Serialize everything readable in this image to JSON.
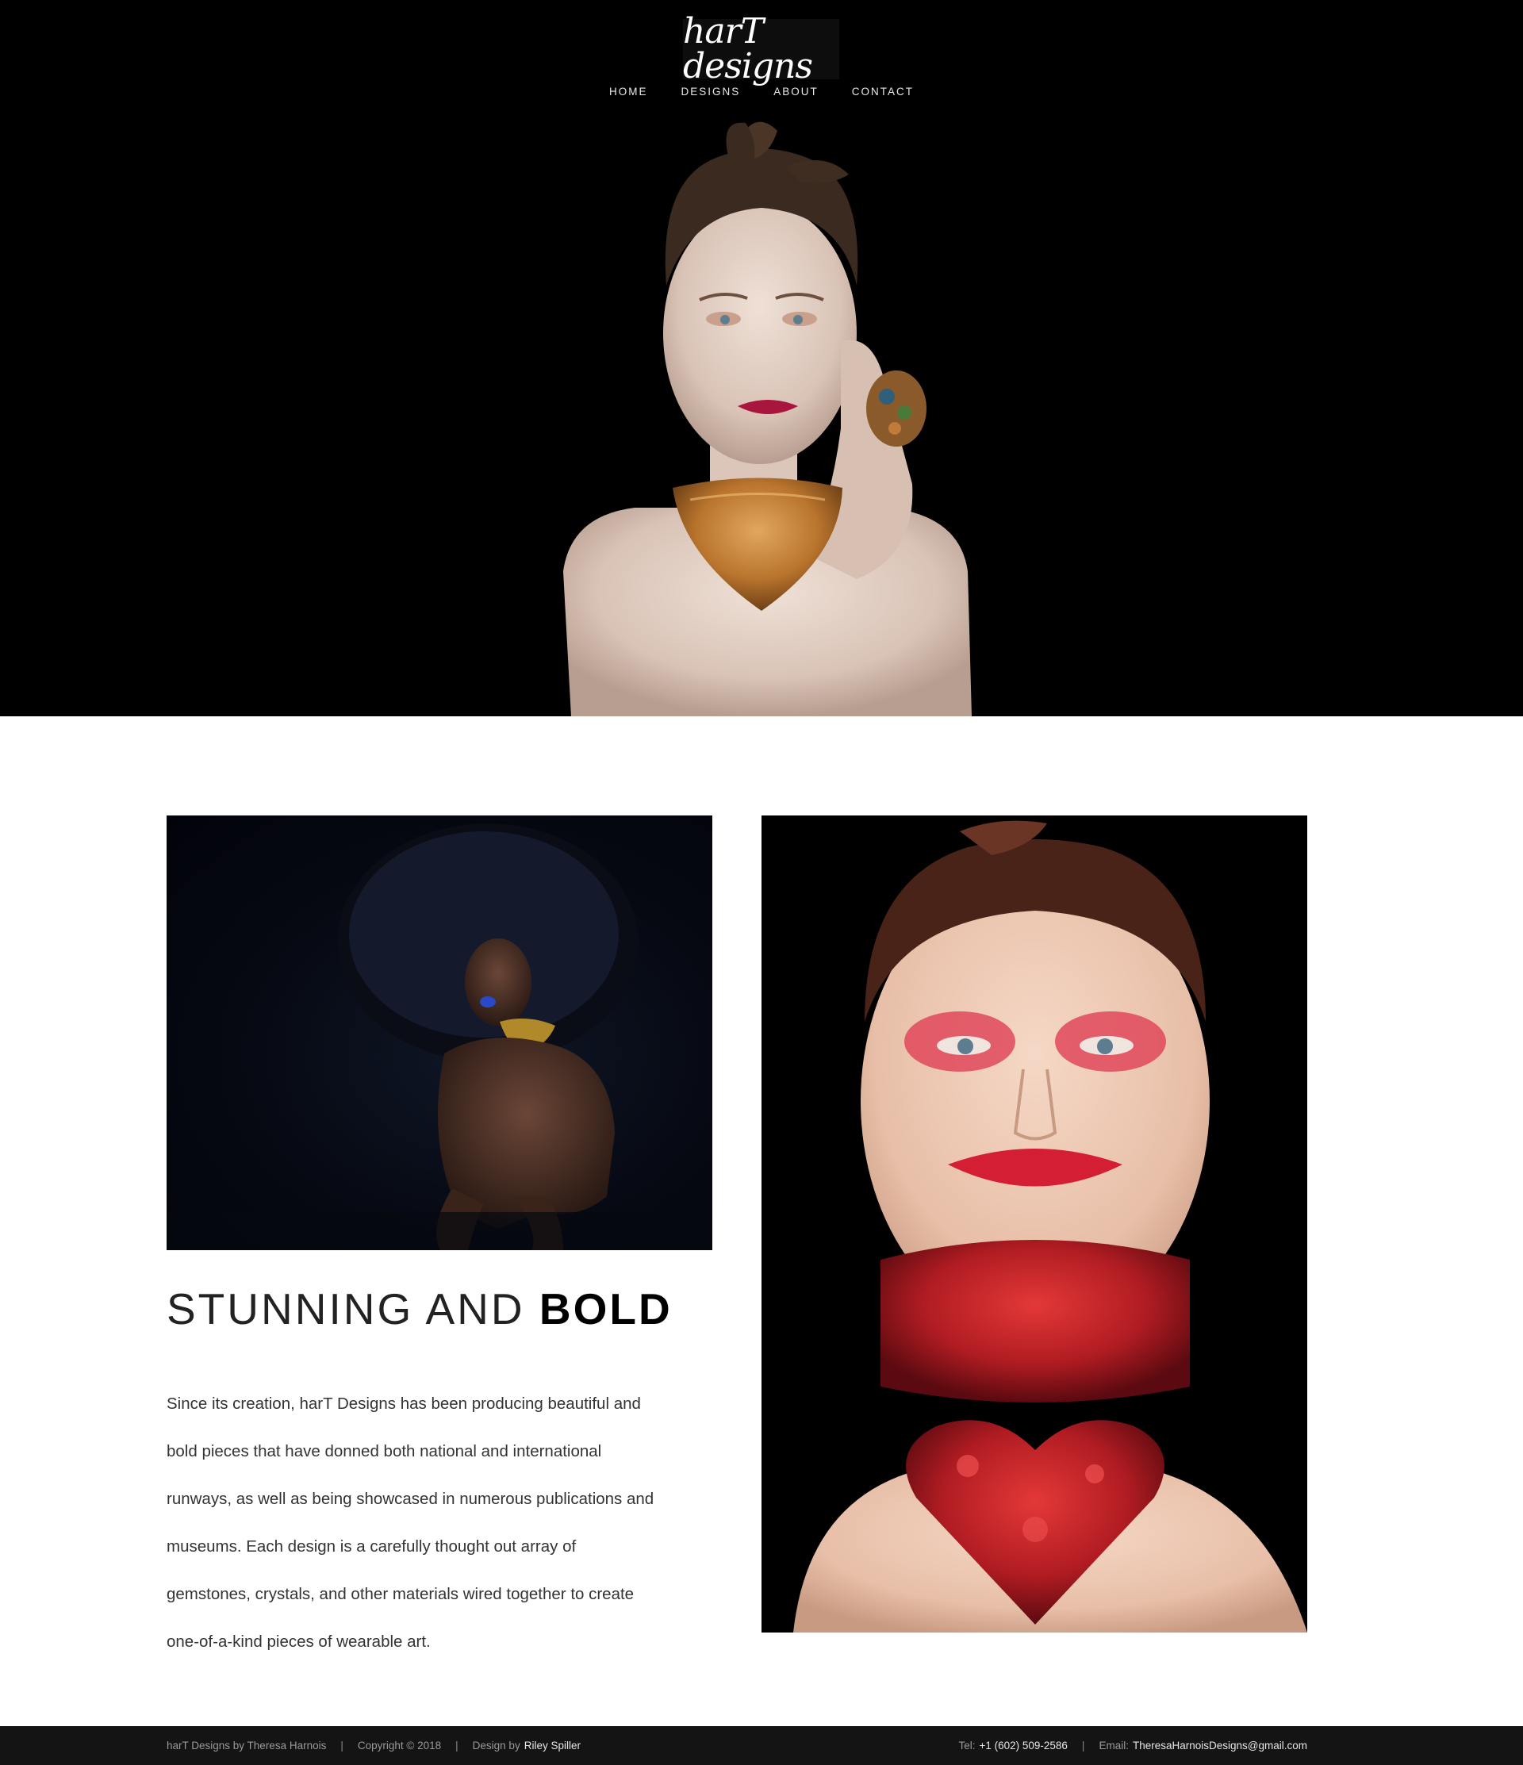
{
  "header": {
    "logo_text": "harT designs",
    "nav": [
      {
        "label": "HOME"
      },
      {
        "label": "DESIGNS"
      },
      {
        "label": "ABOUT"
      },
      {
        "label": "CONTACT"
      }
    ]
  },
  "hero": {
    "background_color": "#000000",
    "image_icon": "model-with-gold-necklace-photo"
  },
  "gallery": {
    "left_image_icon": "model-with-gold-choker-photo",
    "right_image_icon": "model-with-red-heart-necklace-photo"
  },
  "intro": {
    "heading_light": "STUNNING AND ",
    "heading_bold": "BOLD",
    "paragraph_lines": [
      "Since its creation, harT Designs has been producing beautiful and",
      "bold pieces that have donned both national and international",
      "runways, as well as being showcased in numerous publications and",
      "museums. Each design is a carefully thought out array of",
      "gemstones, crystals, and other materials wired together to create",
      "one-of-a-kind pieces of wearable art."
    ]
  },
  "footer": {
    "brand": "harT Designs by Theresa Harnois",
    "separator": "|",
    "copyright": "Copyright © 2018",
    "design_by_prefix": "Design by",
    "designer": "Riley Spiller",
    "tel_prefix": "Tel:",
    "tel": "+1 (602) 509-2586",
    "email_prefix": "Email:",
    "email": "TheresaHarnoisDesigns@gmail.com",
    "background_color": "#141414"
  }
}
